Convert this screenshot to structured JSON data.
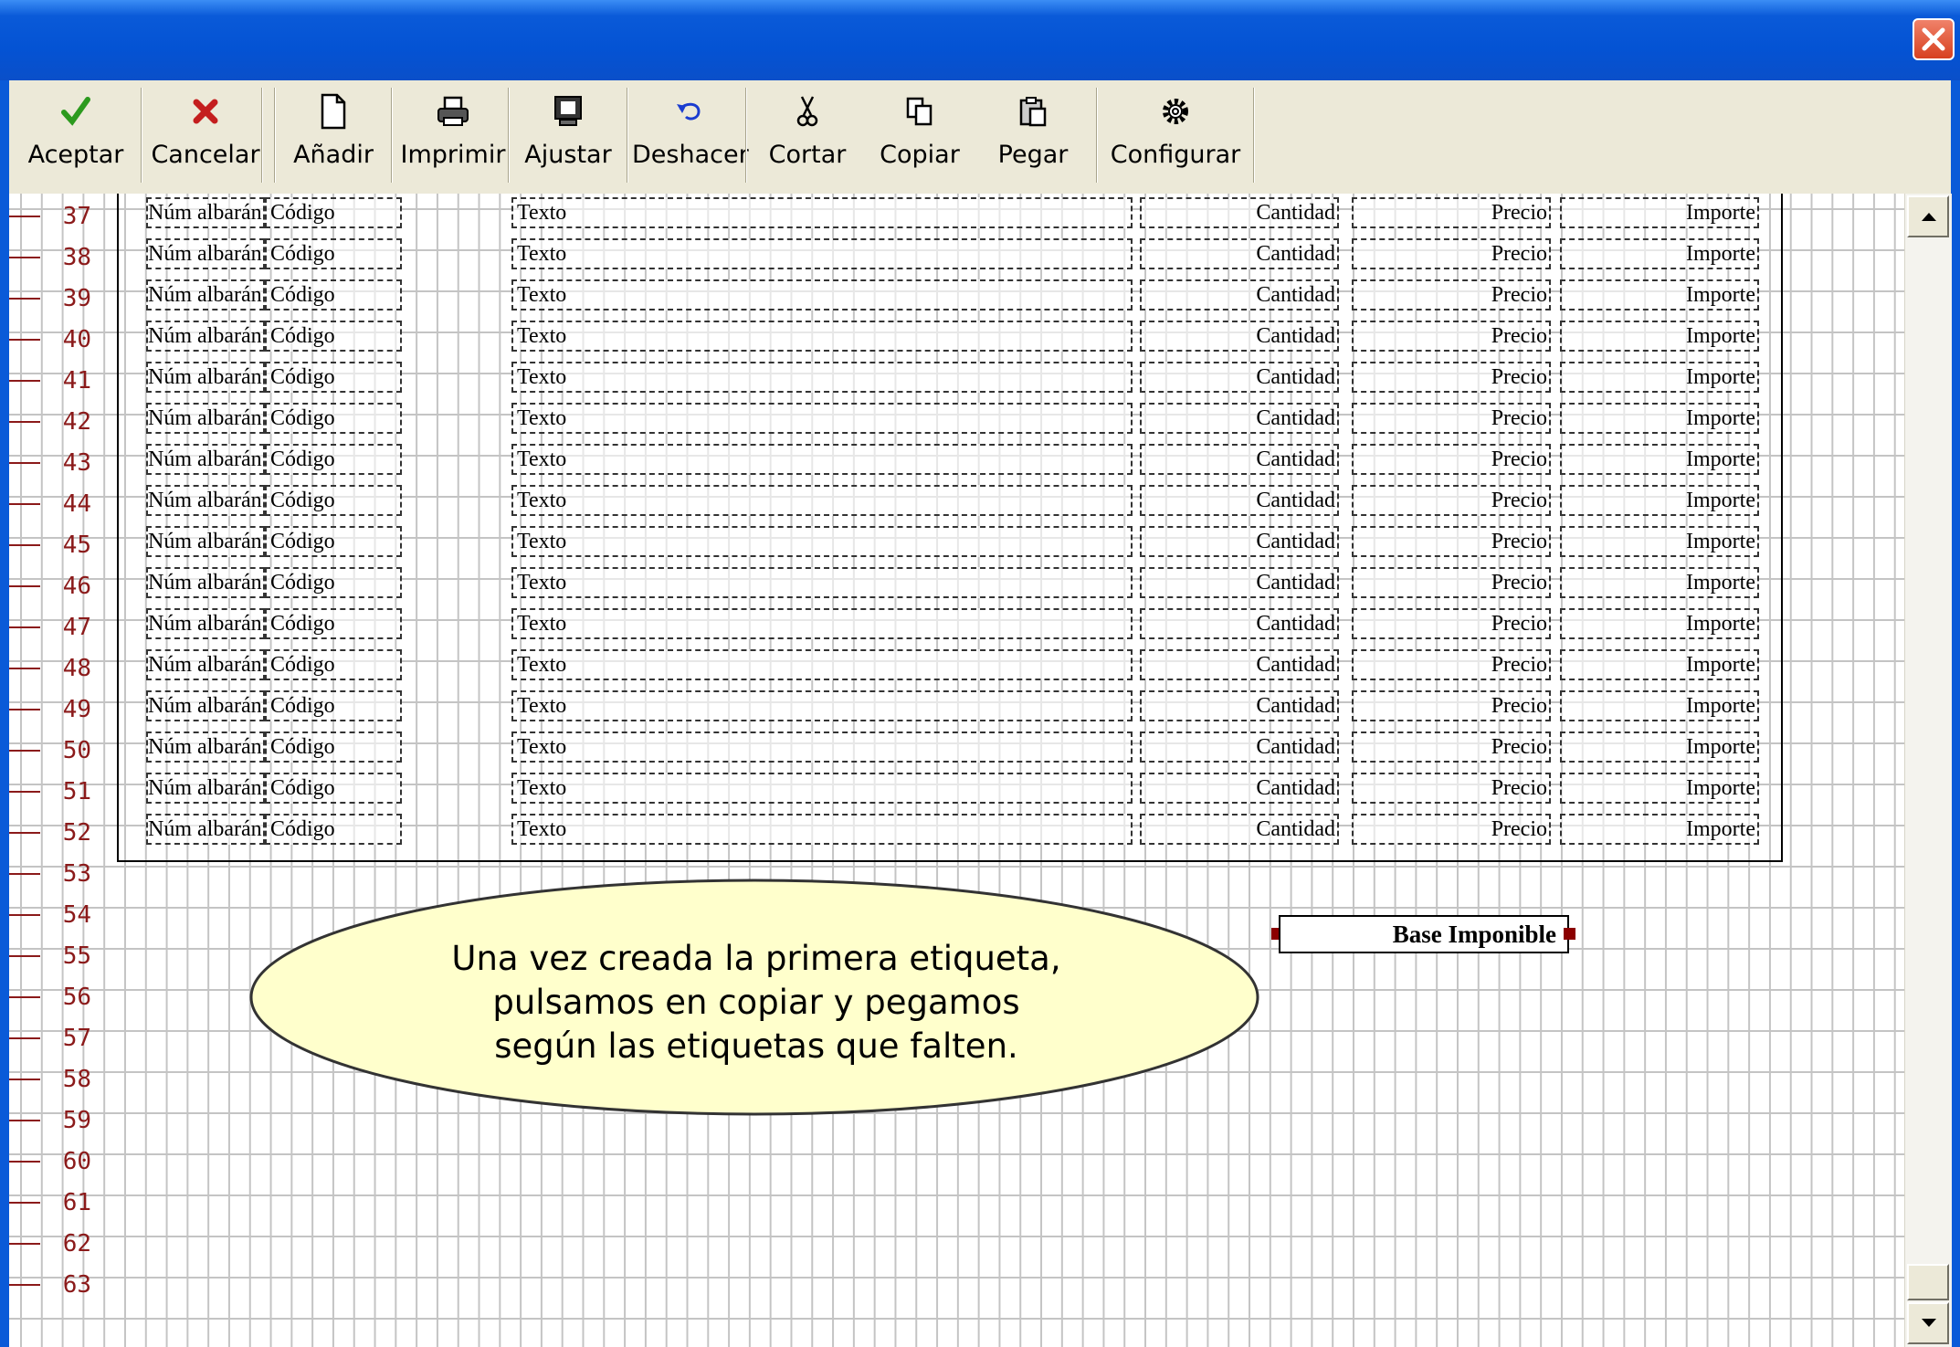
{
  "toolbar": {
    "buttons": [
      {
        "label": "Aceptar",
        "icon": "check-icon"
      },
      {
        "label": "Cancelar",
        "icon": "x-icon"
      },
      {
        "label": "Añadir",
        "icon": "new-page-icon"
      },
      {
        "label": "Imprimir",
        "icon": "printer-icon"
      },
      {
        "label": "Ajustar",
        "icon": "monitor-icon"
      },
      {
        "label": "Deshacer",
        "icon": "undo-icon"
      },
      {
        "label": "Cortar",
        "icon": "scissors-icon"
      },
      {
        "label": "Copiar",
        "icon": "copy-icon"
      },
      {
        "label": "Pegar",
        "icon": "paste-icon"
      },
      {
        "label": "Configurar",
        "icon": "gear-icon"
      }
    ]
  },
  "ruler": {
    "rows": [
      "37",
      "38",
      "39",
      "40",
      "41",
      "42",
      "43",
      "44",
      "45",
      "46",
      "47",
      "48",
      "49",
      "50",
      "51",
      "52",
      "53",
      "54",
      "55",
      "56",
      "57",
      "58",
      "59",
      "60",
      "61",
      "62",
      "63"
    ]
  },
  "detail_rows": {
    "row_numbers": [
      "37",
      "38",
      "39",
      "40",
      "41",
      "42",
      "43",
      "44",
      "45",
      "46",
      "47",
      "48",
      "49",
      "50",
      "51",
      "52"
    ],
    "fields": {
      "num_albaran": "Núm albarán",
      "codigo": "Código",
      "texto": "Texto",
      "cantidad": "Cantidad",
      "precio": "Precio",
      "importe": "Importe"
    }
  },
  "callout": {
    "lines": [
      "Una vez creada la primera etiqueta,",
      "pulsamos en copiar y pegamos",
      "según las etiquetas que falten."
    ]
  },
  "base_label": "Base Imponible",
  "colors": {
    "titlebar": "#0a5ad8",
    "row_numbers": "#8b1a1a",
    "callout_fill": "#ffffcc",
    "handles": "#8b0000"
  }
}
